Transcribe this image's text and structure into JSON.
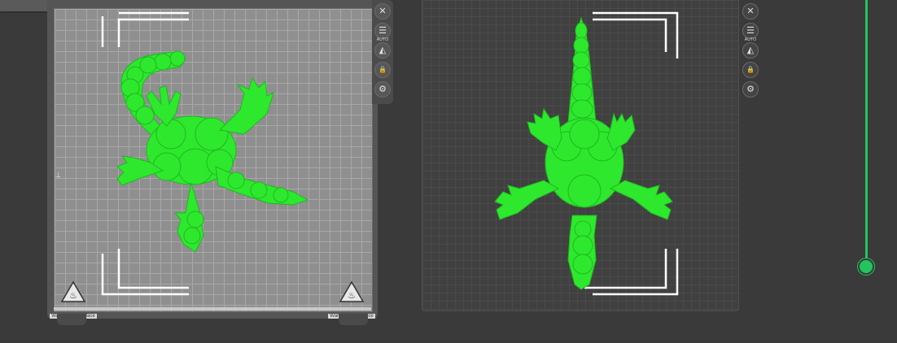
{
  "colors": {
    "model": "#2ee82e",
    "model_shade": "#1fb81f",
    "accent": "#22c55e",
    "bed_light": "#8f8f8f",
    "bed_dark": "#404040",
    "background": "#3a3a3a"
  },
  "left_viewport": {
    "warning_label_left": "Warning hot surface",
    "warning_label_right": "Warning hot surface",
    "tools": [
      {
        "name": "close-icon",
        "glyph": "✕"
      },
      {
        "name": "list-icon",
        "glyph": "☰"
      },
      {
        "name": "auto-orient-icon",
        "glyph": "◭",
        "caption": "AUTO"
      },
      {
        "name": "lock-icon",
        "glyph": "🔒"
      },
      {
        "name": "gear-icon",
        "glyph": "⚙"
      }
    ]
  },
  "right_viewport": {
    "tools": [
      {
        "name": "close-icon",
        "glyph": "✕"
      },
      {
        "name": "list-icon",
        "glyph": "☰"
      },
      {
        "name": "auto-orient-icon",
        "glyph": "◭",
        "caption": "AUTO"
      },
      {
        "name": "lock-icon",
        "glyph": "🔒"
      },
      {
        "name": "gear-icon",
        "glyph": "⚙"
      }
    ]
  }
}
